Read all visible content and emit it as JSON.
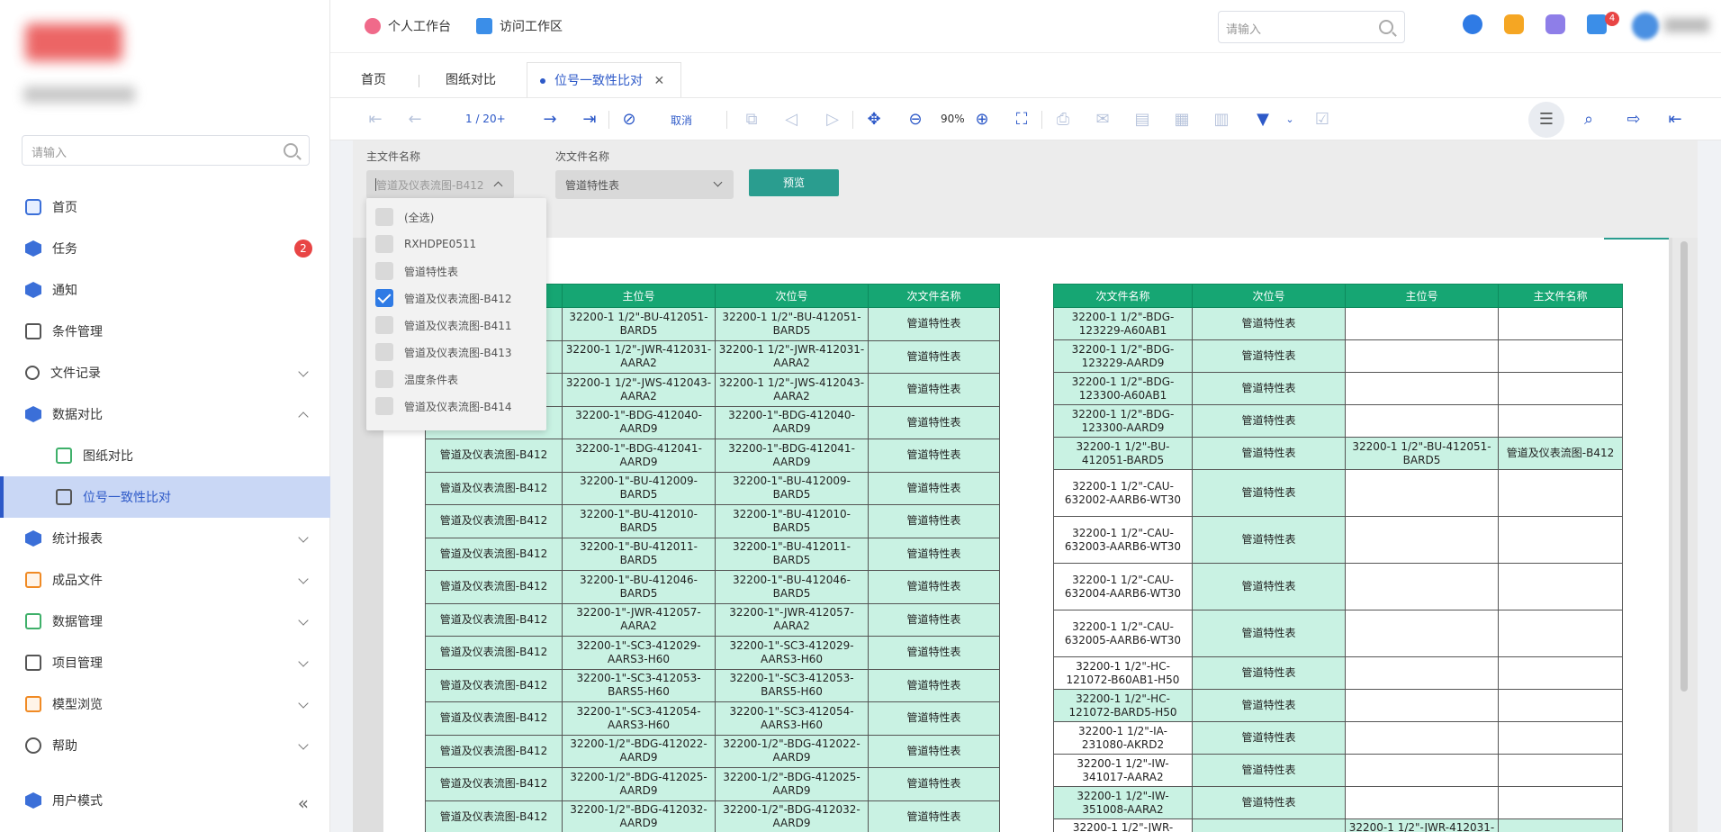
{
  "sidebar": {
    "search_placeholder": "请输入",
    "items": [
      {
        "label": "首页",
        "icon": "home-icon"
      },
      {
        "label": "任务",
        "icon": "task-icon",
        "badge": "2"
      },
      {
        "label": "通知",
        "icon": "notification-icon"
      },
      {
        "label": "条件管理",
        "icon": "condition-icon"
      },
      {
        "label": "文件记录",
        "icon": "person-icon"
      },
      {
        "label": "数据对比",
        "icon": "compare-icon"
      },
      {
        "label": "图纸对比",
        "icon": "drawing-compare-icon"
      },
      {
        "label": "位号一致性比对",
        "icon": "document-icon"
      },
      {
        "label": "统计报表",
        "icon": "report-icon"
      },
      {
        "label": "成品文件",
        "icon": "product-file-icon"
      },
      {
        "label": "数据管理",
        "icon": "data-manage-icon"
      },
      {
        "label": "项目管理",
        "icon": "project-icon"
      },
      {
        "label": "模型浏览",
        "icon": "model-icon"
      },
      {
        "label": "帮助",
        "icon": "help-icon"
      }
    ],
    "user_mode": "用户模式"
  },
  "header": {
    "links": [
      "个人工作台",
      "访问工作区"
    ],
    "search_placeholder": "请输入",
    "message_badge": "4"
  },
  "tabs": [
    "首页",
    "图纸对比",
    "位号一致性比对"
  ],
  "toolbar": {
    "page_indicator": "1 / 20+",
    "cancel_label": "取消",
    "zoom": "90%"
  },
  "filter": {
    "main_label": "主文件名称",
    "main_value": "管道及仪表流图-B412",
    "sub_label": "次文件名称",
    "sub_value": "管道特性表",
    "preview_button": "预览",
    "options": [
      {
        "label": "(全选)",
        "checked": false
      },
      {
        "label": "RXHDPE0511",
        "checked": false
      },
      {
        "label": "管道特性表",
        "checked": false
      },
      {
        "label": "管道及仪表流图-B412",
        "checked": true
      },
      {
        "label": "管道及仪表流图-B411",
        "checked": false
      },
      {
        "label": "管道及仪表流图-B413",
        "checked": false
      },
      {
        "label": "温度条件表",
        "checked": false
      },
      {
        "label": "管道及仪表流图-B414",
        "checked": false
      }
    ]
  },
  "left_table": {
    "headers": [
      "",
      "主位号",
      "次位号",
      "次文件名称"
    ],
    "rows": [
      [
        "",
        "32200-1 1/2\"-BU-412051-BARD5",
        "32200-1 1/2\"-BU-412051-BARD5",
        "管道特性表"
      ],
      [
        "",
        "32200-1 1/2\"-JWR-412031-AARA2",
        "32200-1 1/2\"-JWR-412031-AARA2",
        "管道特性表"
      ],
      [
        "",
        "32200-1 1/2\"-JWS-412043-AARA2",
        "32200-1 1/2\"-JWS-412043-AARA2",
        "管道特性表"
      ],
      [
        "",
        "32200-1\"-BDG-412040-AARD9",
        "32200-1\"-BDG-412040-AARD9",
        "管道特性表"
      ],
      [
        "管道及仪表流图-B412",
        "32200-1\"-BDG-412041-AARD9",
        "32200-1\"-BDG-412041-AARD9",
        "管道特性表"
      ],
      [
        "管道及仪表流图-B412",
        "32200-1\"-BU-412009-BARD5",
        "32200-1\"-BU-412009-BARD5",
        "管道特性表"
      ],
      [
        "管道及仪表流图-B412",
        "32200-1\"-BU-412010-BARD5",
        "32200-1\"-BU-412010-BARD5",
        "管道特性表"
      ],
      [
        "管道及仪表流图-B412",
        "32200-1\"-BU-412011-BARD5",
        "32200-1\"-BU-412011-BARD5",
        "管道特性表"
      ],
      [
        "管道及仪表流图-B412",
        "32200-1\"-BU-412046-BARD5",
        "32200-1\"-BU-412046-BARD5",
        "管道特性表"
      ],
      [
        "管道及仪表流图-B412",
        "32200-1\"-JWR-412057-AARA2",
        "32200-1\"-JWR-412057-AARA2",
        "管道特性表"
      ],
      [
        "管道及仪表流图-B412",
        "32200-1\"-SC3-412029-AARS3-H60",
        "32200-1\"-SC3-412029-AARS3-H60",
        "管道特性表"
      ],
      [
        "管道及仪表流图-B412",
        "32200-1\"-SC3-412053-BARS5-H60",
        "32200-1\"-SC3-412053-BARS5-H60",
        "管道特性表"
      ],
      [
        "管道及仪表流图-B412",
        "32200-1\"-SC3-412054-AARS3-H60",
        "32200-1\"-SC3-412054-AARS3-H60",
        "管道特性表"
      ],
      [
        "管道及仪表流图-B412",
        "32200-1/2\"-BDG-412022-AARD9",
        "32200-1/2\"-BDG-412022-AARD9",
        "管道特性表"
      ],
      [
        "管道及仪表流图-B412",
        "32200-1/2\"-BDG-412025-AARD9",
        "32200-1/2\"-BDG-412025-AARD9",
        "管道特性表"
      ],
      [
        "管道及仪表流图-B412",
        "32200-1/2\"-BDG-412032-AARD9",
        "32200-1/2\"-BDG-412032-AARD9",
        "管道特性表"
      ]
    ]
  },
  "right_table": {
    "headers": [
      "次文件名称",
      "次位号",
      "主位号",
      "主文件名称"
    ],
    "rows": [
      [
        "32200-1 1/2\"-BDG-123229-A60AB1",
        "管道特性表",
        "",
        ""
      ],
      [
        "32200-1 1/2\"-BDG-123229-AARD9",
        "管道特性表",
        "",
        ""
      ],
      [
        "32200-1 1/2\"-BDG-123300-A60AB1",
        "管道特性表",
        "",
        ""
      ],
      [
        "32200-1 1/2\"-BDG-123300-AARD9",
        "管道特性表",
        "",
        ""
      ],
      [
        "32200-1 1/2\"-BU-412051-BARD5",
        "管道特性表",
        "32200-1 1/2\"-BU-412051-BARD5",
        "管道及仪表流图-B412"
      ],
      [
        "32200-1 1/2\"-CAU-632002-AARB6-WT30",
        "管道特性表",
        "",
        ""
      ],
      [
        "32200-1 1/2\"-CAU-632003-AARB6-WT30",
        "管道特性表",
        "",
        ""
      ],
      [
        "32200-1 1/2\"-CAU-632004-AARB6-WT30",
        "管道特性表",
        "",
        ""
      ],
      [
        "32200-1 1/2\"-CAU-632005-AARB6-WT30",
        "管道特性表",
        "",
        ""
      ],
      [
        "32200-1 1/2\"-HC-121072-B60AB1-H50",
        "管道特性表",
        "",
        ""
      ],
      [
        "32200-1 1/2\"-HC-121072-BARD5-H50",
        "管道特性表",
        "",
        ""
      ],
      [
        "32200-1 1/2\"-IA-231080-AKRD2",
        "管道特性表",
        "",
        ""
      ],
      [
        "32200-1 1/2\"-IW-341017-AARA2",
        "管道特性表",
        "",
        ""
      ],
      [
        "32200-1 1/2\"-IW-351008-AARA2",
        "管道特性表",
        "",
        ""
      ],
      [
        "32200-1 1/2\"-JWR-",
        "",
        "32200-1 1/2\"-JWR-412031-",
        ""
      ]
    ]
  }
}
